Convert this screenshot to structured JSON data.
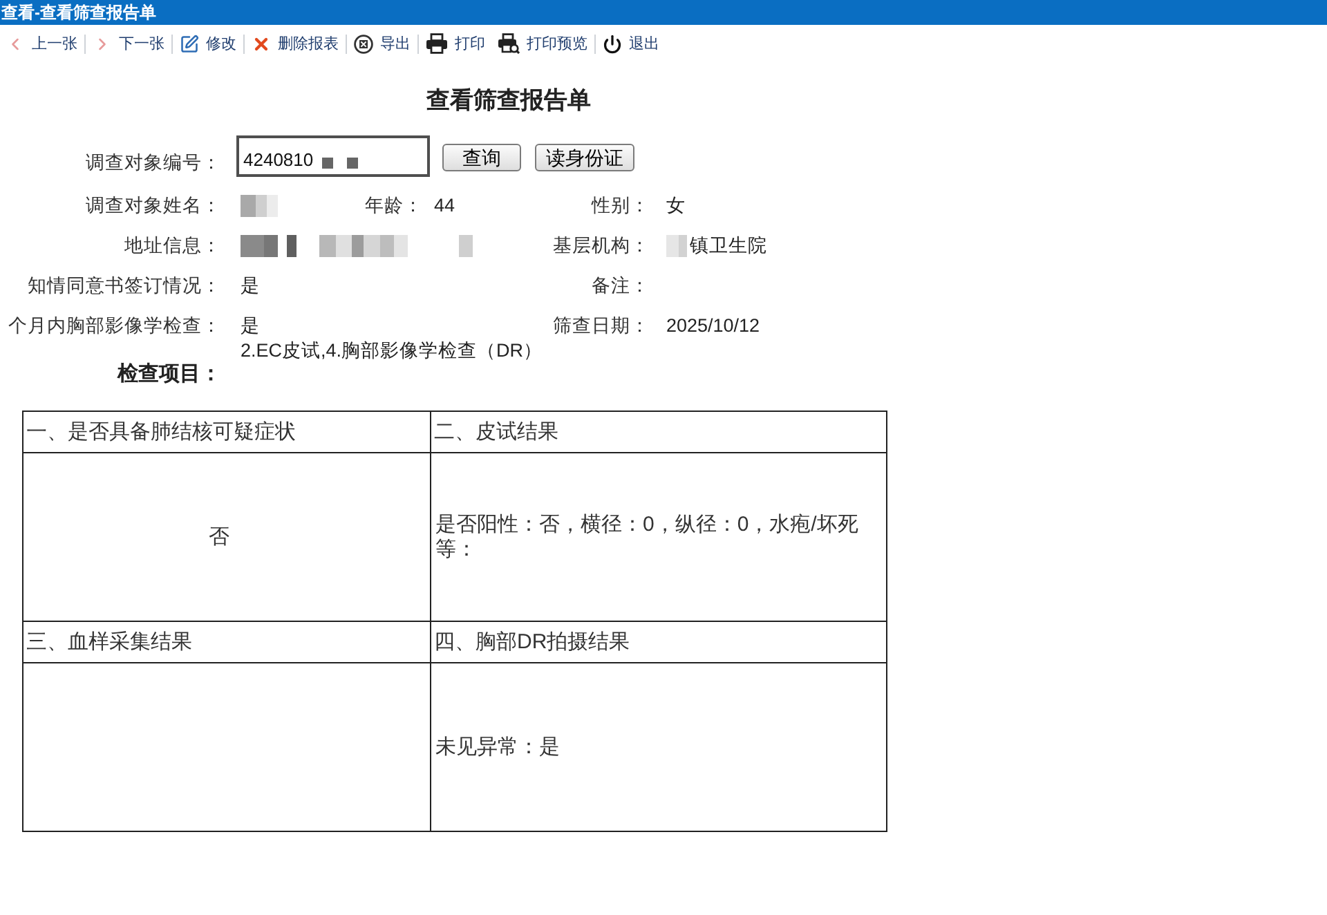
{
  "window": {
    "title": "查看-查看筛查报告单"
  },
  "toolbar_groups": [
    [
      {
        "kind": "previous",
        "label": "上一张"
      }
    ],
    [
      {
        "kind": "next",
        "label": "下一张"
      }
    ],
    [
      {
        "kind": "edit",
        "label": "修改"
      }
    ],
    [
      {
        "kind": "delete",
        "label": "删除报表"
      }
    ],
    [
      {
        "kind": "export",
        "label": "导出"
      }
    ],
    [
      {
        "kind": "print",
        "label": "打印"
      },
      {
        "kind": "preview",
        "label": "打印预览"
      }
    ],
    [
      {
        "kind": "exit",
        "label": "退出"
      }
    ]
  ],
  "heading": "查看筛查报告单",
  "id_row": {
    "label": "调查对象编号：",
    "value": "4240810",
    "redacted": true,
    "buttons": [
      "查询",
      "读身份证"
    ]
  },
  "fields": [
    [
      {
        "label": "调查对象姓名：",
        "redacted": true
      },
      {
        "label": "年龄：",
        "value": "44",
        "redacted": false
      },
      {
        "label": "性别：",
        "value": "女",
        "redacted": false
      }
    ],
    [
      {
        "label": "地址信息：",
        "redacted": true
      },
      {
        "label": "基层机构：",
        "value": "镇卫生院",
        "redacted": true
      }
    ],
    [
      {
        "label": "知情同意书签订情况：",
        "value": "是",
        "redacted": false
      },
      {
        "label": "备注：",
        "redacted": false
      }
    ],
    [
      {
        "label": "个月内胸部影像学检查：",
        "value": "是",
        "redacted": false
      },
      {
        "label": "筛查日期：",
        "value": "2025/10/12",
        "redacted": false
      }
    ]
  ],
  "exam_items": {
    "label": "检查项目：",
    "value": "2.EC皮试,4.胸部影像学检查（DR）"
  },
  "sections": [
    {
      "title": "一、是否具备肺结核可疑症状",
      "content": "否",
      "centered": true
    },
    {
      "title": "二、皮试结果",
      "content": "是否阳性：否，横径：0，纵径：0，水疱/坏死等：",
      "centered": false
    },
    {
      "title": "三、血样采集结果"
    },
    {
      "title": "四、胸部DR拍摄结果",
      "content": "未见异常：是",
      "centered": false
    }
  ]
}
